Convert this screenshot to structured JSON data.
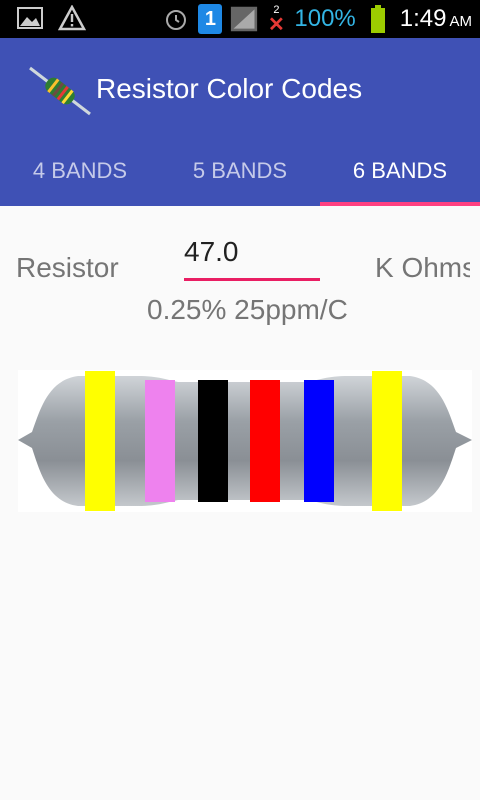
{
  "status_bar": {
    "battery_percent": "100%",
    "time": "1:49",
    "ampm": "AM",
    "sim_indicator": "1",
    "missed_count": "2",
    "icons": [
      "image-icon",
      "warning-icon",
      "alarm-icon",
      "sim-icon",
      "signal-icon",
      "missed-call-icon",
      "battery-icon"
    ]
  },
  "app": {
    "title": "Resistor Color Codes"
  },
  "tabs": [
    {
      "label": "4 BANDS",
      "active": false
    },
    {
      "label": "5 BANDS",
      "active": false
    },
    {
      "label": "6 BANDS",
      "active": true
    }
  ],
  "form": {
    "label": "Resistor",
    "value": "47.0",
    "unit": "K Ohms",
    "tolerance": "0.25% 25ppm/C"
  },
  "resistor_bands": [
    {
      "name": "yellow",
      "color": "#ffff00"
    },
    {
      "name": "violet",
      "color": "#ee82ee"
    },
    {
      "name": "black",
      "color": "#000000"
    },
    {
      "name": "red",
      "color": "#ff0000"
    },
    {
      "name": "blue",
      "color": "#0000ff"
    },
    {
      "name": "yellow",
      "color": "#ffff00"
    }
  ],
  "colors": {
    "primary": "#3f51b5",
    "accent": "#ff4081"
  }
}
